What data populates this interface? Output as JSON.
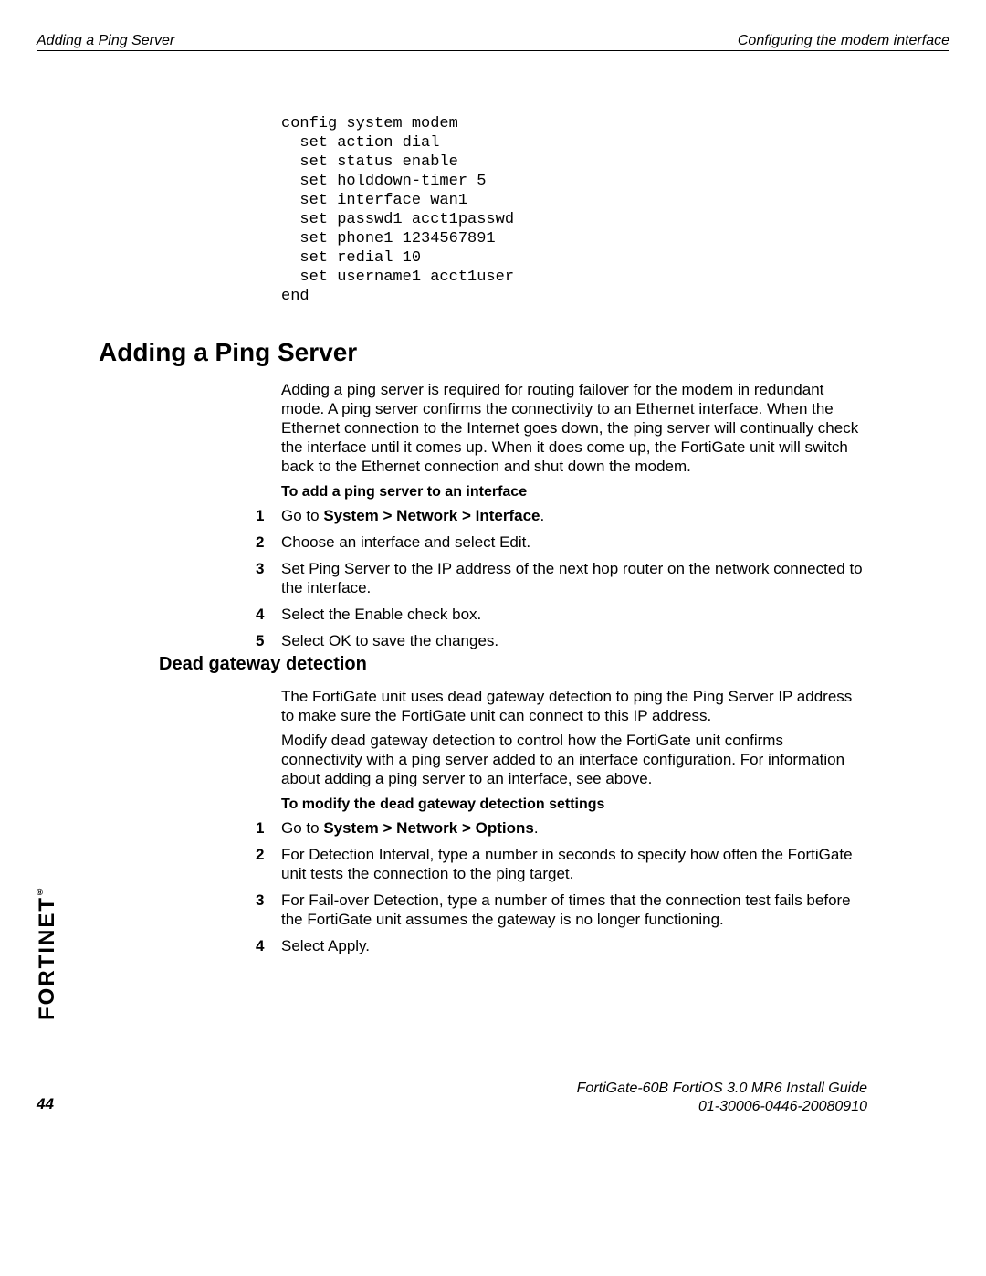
{
  "header": {
    "left": "Adding a Ping Server",
    "right": "Configuring the modem interface"
  },
  "code_block": "config system modem\n  set action dial\n  set status enable\n  set holddown-timer 5\n  set interface wan1\n  set passwd1 acct1passwd\n  set phone1 1234567891\n  set redial 10\n  set username1 acct1user\nend",
  "section": {
    "title": "Adding a Ping Server",
    "intro": "Adding a ping server is required for routing failover for the modem in redundant mode. A ping server confirms the connectivity to an Ethernet interface. When the Ethernet connection to the Internet goes down, the ping server will continually check the interface until it comes up. When it does come up, the FortiGate unit will switch back to the Ethernet connection and shut down the modem.",
    "proc1_title": "To add a ping server to an interface",
    "steps1": [
      {
        "n": "1",
        "pre": "Go to ",
        "bold": "System > Network > Interface",
        "post": "."
      },
      {
        "n": "2",
        "pre": "Choose an interface and select Edit.",
        "bold": "",
        "post": ""
      },
      {
        "n": "3",
        "pre": "Set Ping Server to the IP address of the next hop router on the network connected to the interface.",
        "bold": "",
        "post": ""
      },
      {
        "n": "4",
        "pre": "Select the Enable check box.",
        "bold": "",
        "post": ""
      },
      {
        "n": "5",
        "pre": "Select OK to save the changes.",
        "bold": "",
        "post": ""
      }
    ]
  },
  "subsection": {
    "title": "Dead gateway detection",
    "p1": "The FortiGate unit uses dead gateway detection to ping the Ping Server IP address to make sure the FortiGate unit can connect to this IP address.",
    "p2": "Modify dead gateway detection to control how the FortiGate unit confirms connectivity with a ping server added to an interface configuration. For information about adding a ping server to an interface, see above.",
    "proc2_title": "To modify the dead gateway detection settings",
    "steps2": [
      {
        "n": "1",
        "pre": "Go to ",
        "bold": "System > Network > Options",
        "post": "."
      },
      {
        "n": "2",
        "pre": "For Detection Interval, type a number in seconds to specify how often the FortiGate unit tests the connection to the ping target.",
        "bold": "",
        "post": ""
      },
      {
        "n": "3",
        "pre": "For Fail-over Detection, type a number of times that the connection test fails before the FortiGate unit assumes the gateway is no longer functioning.",
        "bold": "",
        "post": ""
      },
      {
        "n": "4",
        "pre": "Select Apply.",
        "bold": "",
        "post": ""
      }
    ]
  },
  "brand": "FORTINET",
  "footer": {
    "line1": "FortiGate-60B FortiOS 3.0 MR6 Install Guide",
    "line2": "01-30006-0446-20080910",
    "page": "44"
  }
}
